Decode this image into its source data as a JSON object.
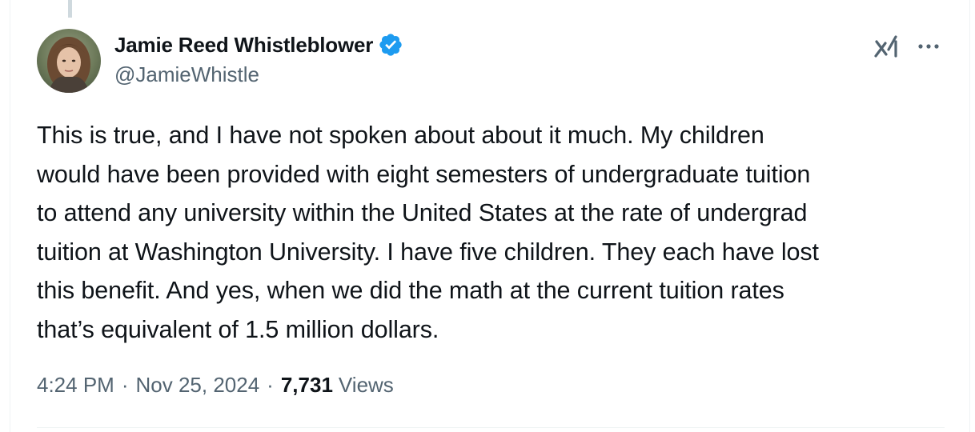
{
  "tweet": {
    "author": {
      "display_name": "Jamie Reed Whistleblower",
      "handle": "@JamieWhistle",
      "verified": true
    },
    "text_lines": [
      "This is true, and I have not spoken about about it much. My children",
      "would have been provided with eight semesters of undergraduate tuition",
      "to attend any university within the United States at the rate of undergrad",
      "tuition at Washington University. I have five children. They each have lost",
      "this benefit. And yes, when we did the math at the current tuition rates",
      "that’s equivalent of 1.5 million dollars."
    ],
    "meta": {
      "time": "4:24 PM",
      "separator": "·",
      "date": "Nov 25, 2024",
      "views_count": "7,731",
      "views_label": "Views"
    }
  },
  "icons": {
    "verified": "verified-badge-icon",
    "grok": "grok-icon",
    "more": "more-options-icon"
  },
  "colors": {
    "text_primary": "#0f1419",
    "text_secondary": "#536471",
    "verified_blue": "#1d9bf0",
    "divider": "#eff3f4"
  }
}
